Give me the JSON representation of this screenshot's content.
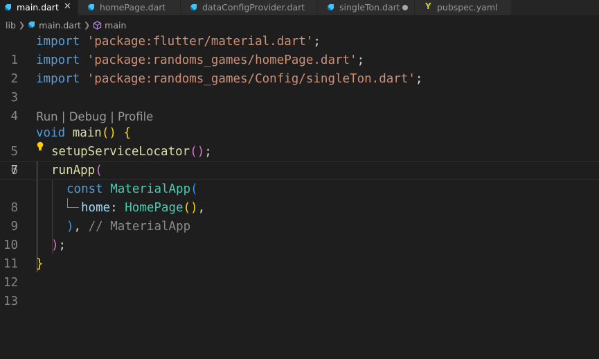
{
  "tabs": [
    {
      "label": "main.dart",
      "icon": "dart-icon",
      "active": true,
      "state": "close-icon"
    },
    {
      "label": "homePage.dart",
      "icon": "dart-icon",
      "active": false,
      "state": ""
    },
    {
      "label": "dataConfigProvider.dart",
      "icon": "dart-icon",
      "active": false,
      "state": ""
    },
    {
      "label": "singleTon.dart",
      "icon": "dart-icon",
      "active": false,
      "state": "modified-dot"
    },
    {
      "label": "pubspec.yaml",
      "icon": "yaml-icon",
      "active": false,
      "state": ""
    }
  ],
  "tab_close_glyph": "✕",
  "yaml_glyph": "Y",
  "breadcrumb": {
    "folder": "lib",
    "file": "main.dart",
    "symbol": "main"
  },
  "codelens": {
    "run": "Run",
    "sep1": " | ",
    "debug": "Debug",
    "sep2": " | ",
    "profile": "Profile"
  },
  "line_numbers": [
    "1",
    "2",
    "3",
    "4",
    "5",
    "6",
    "7",
    "8",
    "9",
    "10",
    "11",
    "12",
    "13"
  ],
  "current_line": "7",
  "code": {
    "l1_kw": "import",
    "l1_str": "'package:flutter/material.dart'",
    "l2_kw": "import",
    "l2_str": "'package:randoms_games/homePage.dart'",
    "l3_kw": "import",
    "l3_str": "'package:randoms_games/Config/singleTon.dart'",
    "semicolon": ";",
    "l5_kw": "void",
    "l5_fn": "main",
    "l5_paren": "()",
    "l5_brace": "{",
    "l6_fn": "setupServiceLocator",
    "l6_paren": "()",
    "l7_fn": "runApp",
    "l7_paren": "(",
    "l8_kw": "const",
    "l8_type": "MaterialApp",
    "l8_paren": "(",
    "l9_prop": "home",
    "l9_colon": ":",
    "l9_type": "HomePage",
    "l9_paren": "()",
    "l9_comma": ",",
    "l10_paren": ")",
    "l10_comma": ",",
    "l10_comment": "// MaterialApp",
    "l11_paren": ")",
    "l12_brace": "}"
  },
  "colors": {
    "background": "#1e1e1e",
    "keyword": "#569cd6",
    "string": "#ce9178",
    "function": "#dcdcaa",
    "type": "#4ec9b0",
    "bracket_gold": "#ffd700",
    "bracket_pink": "#da70d6",
    "bracket_blue": "#179fff"
  }
}
